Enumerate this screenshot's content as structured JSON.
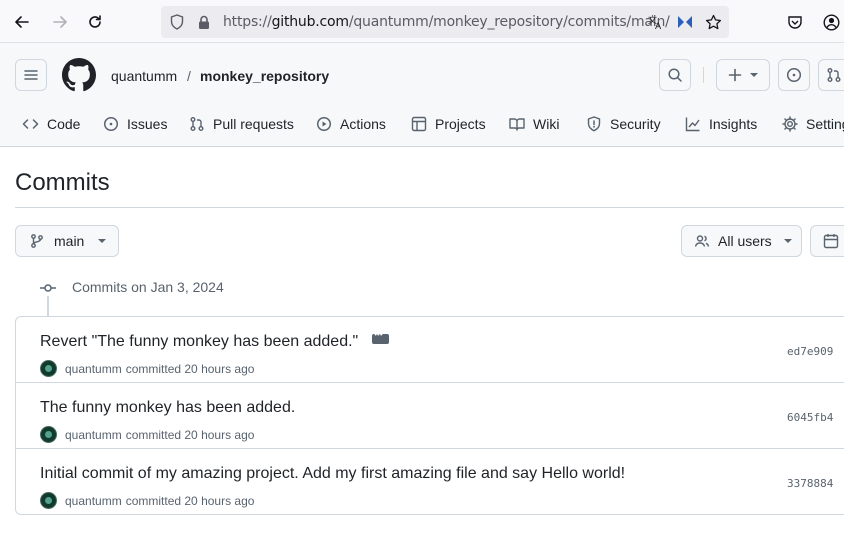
{
  "browser": {
    "url_prefix": "https://",
    "url_host": "github.com",
    "url_path": "/quantumm/monkey_repository/commits/main/"
  },
  "header": {
    "owner": "quantumm",
    "separator": "/",
    "repo": "monkey_repository"
  },
  "tabs": [
    {
      "label": "Code",
      "icon": "code-icon"
    },
    {
      "label": "Issues",
      "icon": "issue-icon"
    },
    {
      "label": "Pull requests",
      "icon": "pull-request-icon"
    },
    {
      "label": "Actions",
      "icon": "play-icon"
    },
    {
      "label": "Projects",
      "icon": "table-icon"
    },
    {
      "label": "Wiki",
      "icon": "book-icon"
    },
    {
      "label": "Security",
      "icon": "shield-icon"
    },
    {
      "label": "Insights",
      "icon": "graph-icon"
    },
    {
      "label": "Settings",
      "icon": "gear-icon"
    }
  ],
  "page": {
    "title": "Commits",
    "branch": "main",
    "users_filter": "All users"
  },
  "timeline": {
    "label": "Commits on Jan 3, 2024"
  },
  "commits": [
    {
      "message": "Revert \"The funny monkey has been added.\"",
      "author": "quantumm",
      "action": "committed 20 hours ago",
      "sha": "ed7e909",
      "has_ellipsis": true
    },
    {
      "message": "The funny monkey has been added.",
      "author": "quantumm",
      "action": "committed 20 hours ago",
      "sha": "6045fb4",
      "has_ellipsis": false
    },
    {
      "message": "Initial commit of my amazing project. Add my first amazing file and say Hello world!",
      "author": "quantumm",
      "action": "committed 20 hours ago",
      "sha": "3378884",
      "has_ellipsis": false
    }
  ],
  "colors": {
    "border": "#d0d7de",
    "muted": "#59636e",
    "text": "#1f2328"
  }
}
